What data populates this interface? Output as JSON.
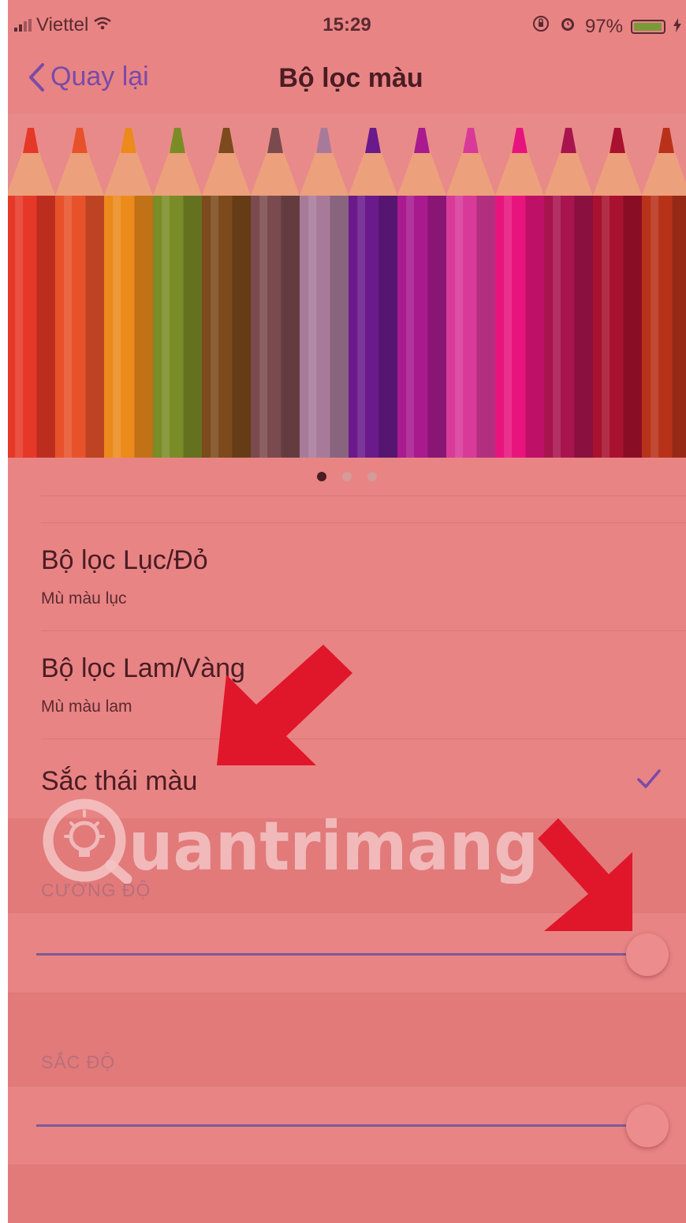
{
  "status_bar": {
    "carrier": "Viettel",
    "time": "15:29",
    "battery": "97%",
    "battery_level": 0.97
  },
  "nav": {
    "back_label": "Quay lại",
    "title": "Bộ lọc màu"
  },
  "banner": {
    "pencil_colors": [
      "#e63828",
      "#e8522a",
      "#ec8a1c",
      "#7a8c26",
      "#7c4a1c",
      "#7a4a4e",
      "#a87a9a",
      "#6a1a8a",
      "#a81a8e",
      "#d83a9a",
      "#e8147e",
      "#a8144e",
      "#a8122e",
      "#b8321a"
    ],
    "page_count": 3,
    "active_page": 1
  },
  "filters": [
    {
      "title": "Bộ lọc Lục/Đỏ",
      "subtitle": "Mù màu lục"
    },
    {
      "title": "Bộ lọc Lam/Vàng",
      "subtitle": "Mù màu lam"
    },
    {
      "title": "Sắc thái màu",
      "subtitle": "",
      "selected": true
    }
  ],
  "intensity": {
    "header": "CƯỜNG ĐỘ",
    "value": 1.0
  },
  "hue": {
    "header": "SẮC ĐỘ",
    "value": 1.0
  },
  "watermark": {
    "text": "uantrimang"
  },
  "colors": {
    "accent": "#7a4aa8",
    "arrow": "#e0162a",
    "overlay": "#e98484"
  }
}
